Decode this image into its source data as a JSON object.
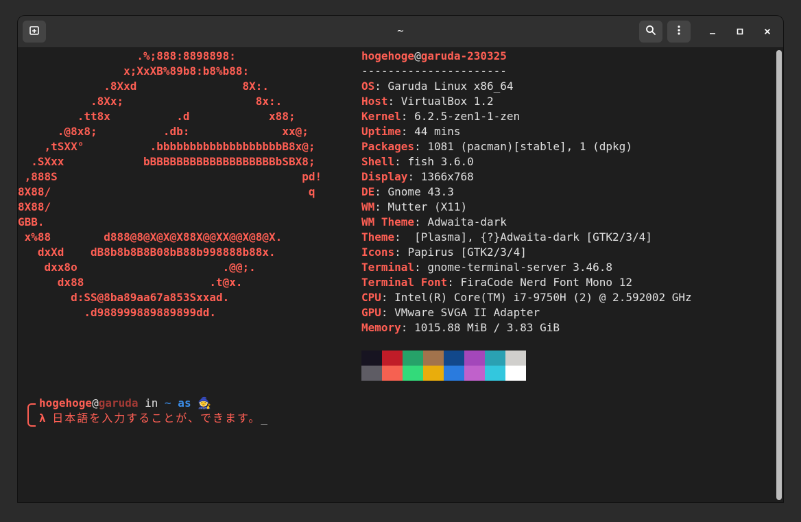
{
  "window": {
    "title": "~",
    "icons": {
      "new_tab": "new-tab-icon",
      "search": "search-icon",
      "menu": "kebab-menu-icon",
      "minimize": "minimize-icon",
      "maximize": "maximize-icon",
      "close": "close-icon"
    }
  },
  "art": [
    "                  .%;888:8898898:",
    "                x;XxXB%89b8:b8%b88:",
    "             .8Xxd                8X:.",
    "           .8Xx;                    8x:.",
    "         .tt8x          .d            x88;",
    "      .@8x8;          .db:              xx@;",
    "    ,tSXX°          .bbbbbbbbbbbbbbbbbbbB8x@;",
    "  .SXxx            bBBBBBBBBBBBBBBBBBBBbSBX8;",
    " ,888S                                     pd!",
    "8X88/                                       q",
    "8X88/",
    "GBB.",
    " x%88        d888@8@X@X@X88X@@XX@@X@8@X.",
    "   dxXd    dB8b8b8B8B08bB88b998888b88x.",
    "    dxx8o                      .@@;.",
    "      dx88                   .t@x.",
    "        d:SS@8ba89aa67a853Sxxad.",
    "          .d988999889889899dd."
  ],
  "header": {
    "user": "hogehoge",
    "at": "@",
    "host": "garuda-230325",
    "separator": "----------------------"
  },
  "info": [
    {
      "key": "OS",
      "value": ": Garuda Linux x86_64"
    },
    {
      "key": "Host",
      "value": ": VirtualBox 1.2"
    },
    {
      "key": "Kernel",
      "value": ": 6.2.5-zen1-1-zen"
    },
    {
      "key": "Uptime",
      "value": ": 44 mins"
    },
    {
      "key": "Packages",
      "value": ": 1081 (pacman)[stable], 1 (dpkg)"
    },
    {
      "key": "Shell",
      "value": ": fish 3.6.0"
    },
    {
      "key": "Display",
      "value": ": 1366x768"
    },
    {
      "key": "DE",
      "value": ": Gnome 43.3"
    },
    {
      "key": "WM",
      "value": ": Mutter (X11)"
    },
    {
      "key": "WM Theme",
      "value": ": Adwaita-dark"
    },
    {
      "key": "Theme",
      "value": ":  [Plasma], {?}Adwaita-dark [GTK2/3/4]"
    },
    {
      "key": "Icons",
      "value": ": Papirus [GTK2/3/4]"
    },
    {
      "key": "Terminal",
      "value": ": gnome-terminal-server 3.46.8"
    },
    {
      "key": "Terminal Font",
      "value": ": FiraCode Nerd Font Mono 12"
    },
    {
      "key": "CPU",
      "value": ": Intel(R) Core(TM) i7-9750H (2) @ 2.592002 GHz"
    },
    {
      "key": "GPU",
      "value": ": VMware SVGA II Adapter"
    },
    {
      "key": "Memory",
      "value": ": 1015.88 MiB / 3.83 GiB"
    }
  ],
  "palette": {
    "row1": [
      "#171421",
      "#c01c28",
      "#26a269",
      "#a2734c",
      "#12488b",
      "#a347ba",
      "#2aa1b3",
      "#d0cfcc"
    ],
    "row2": [
      "#5e5c64",
      "#f66151",
      "#33da7a",
      "#e9ad0c",
      "#2a7bde",
      "#c061cb",
      "#33c7de",
      "#ffffff"
    ]
  },
  "prompt": {
    "user": "hogehoge",
    "at": "@",
    "host": "garuda",
    "in": " in ",
    "dir": "~",
    "as": " as ",
    "wizard": "🧙",
    "lambda": "λ",
    "input": "日本語を入力することが、できます。",
    "cursor": "_"
  },
  "colors": {
    "accent": "#ff5f54",
    "host_dim": "#a33a35",
    "blue": "#3b8eea"
  }
}
